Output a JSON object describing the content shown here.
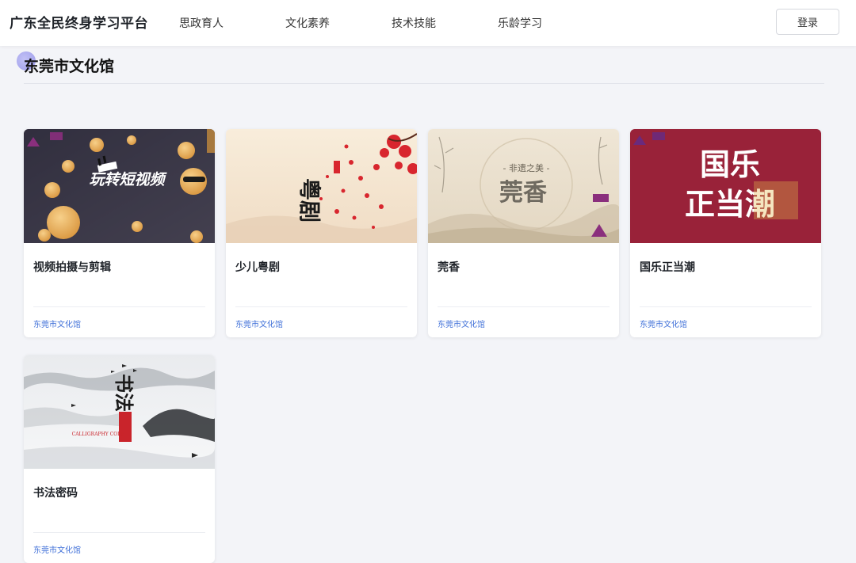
{
  "header": {
    "brand": "广东全民终身学习平台",
    "nav": [
      "思政育人",
      "文化素养",
      "技术技能",
      "乐龄学习"
    ],
    "login_label": "登录"
  },
  "section": {
    "title": "东莞市文化馆"
  },
  "courses": [
    {
      "title": "视频拍摄与剪辑",
      "org": "东莞市文化馆",
      "thumb_text": "玩转短视频"
    },
    {
      "title": "少儿粤剧",
      "org": "东莞市文化馆",
      "thumb_text": "粤剧"
    },
    {
      "title": "莞香",
      "org": "东莞市文化馆",
      "thumb_text": "莞香",
      "thumb_subtext": "- 非遗之美 -"
    },
    {
      "title": "国乐正当潮",
      "org": "东莞市文化馆",
      "thumb_text_line1": "国乐",
      "thumb_text_line2": "正当潮"
    },
    {
      "title": "书法密码",
      "org": "东莞市文化馆",
      "thumb_text": "书法",
      "thumb_subtext": "CALLIGRAPHY CODE"
    }
  ],
  "colors": {
    "accent_blue": "#3f6fd8",
    "card_bg": "#ffffff",
    "page_bg": "#f3f4f8",
    "guoyue_red": "#a3243c"
  }
}
